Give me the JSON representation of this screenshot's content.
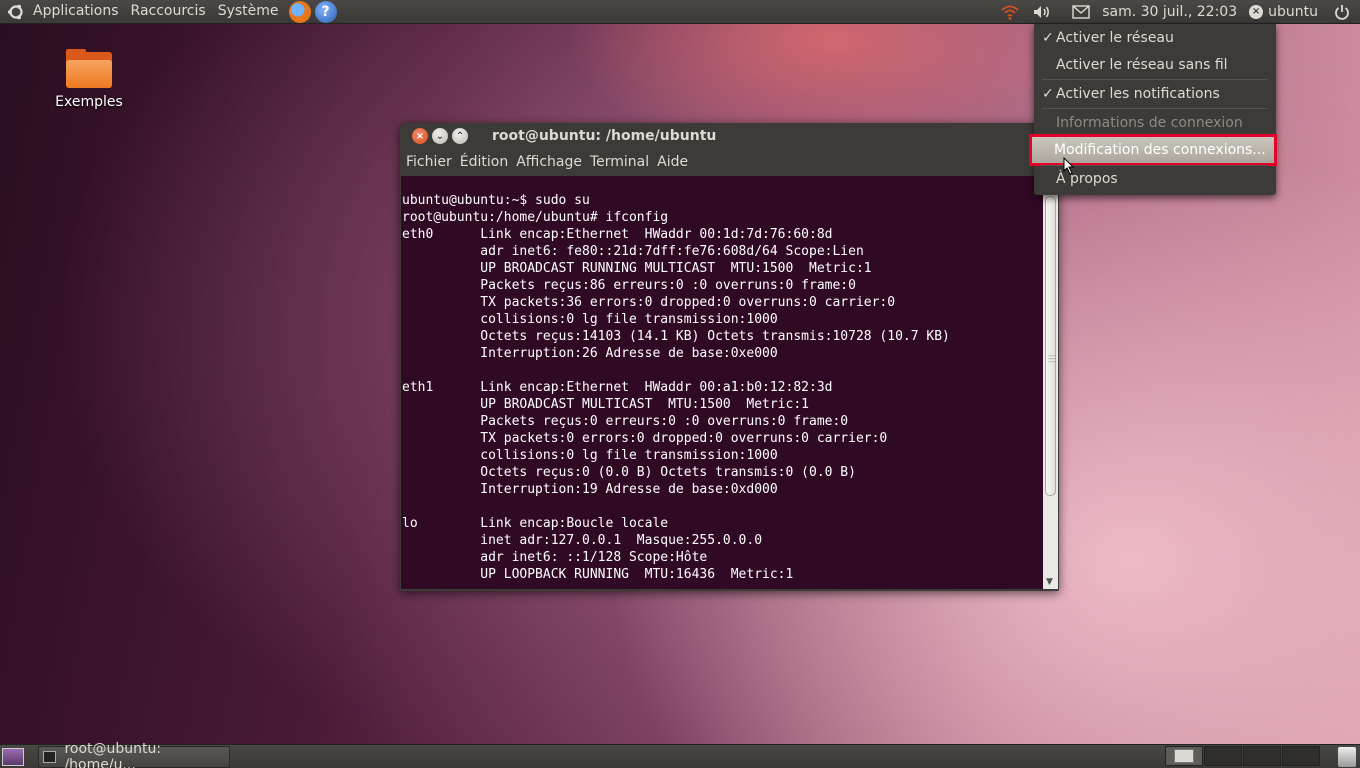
{
  "top_panel": {
    "menus": [
      "Applications",
      "Raccourcis",
      "Système"
    ],
    "help_glyph": "?",
    "clock": "sam. 30 juil., 22:03",
    "user": "ubuntu",
    "icons": [
      "ubuntu-logo-icon",
      "firefox-icon",
      "help-icon",
      "network-icon",
      "volume-icon",
      "mail-icon",
      "user-status-icon",
      "power-icon"
    ]
  },
  "desktop": {
    "icons": [
      {
        "label": "Exemples",
        "icon": "folder-icon"
      }
    ]
  },
  "terminal": {
    "title": "root@ubuntu: /home/ubuntu",
    "menu": [
      "Fichier",
      "Édition",
      "Affichage",
      "Terminal",
      "Aide"
    ],
    "lines": [
      "ubuntu@ubuntu:~$ sudo su",
      "root@ubuntu:/home/ubuntu# ifconfig",
      "eth0      Link encap:Ethernet  HWaddr 00:1d:7d:76:60:8d",
      "          adr inet6: fe80::21d:7dff:fe76:608d/64 Scope:Lien",
      "          UP BROADCAST RUNNING MULTICAST  MTU:1500  Metric:1",
      "          Packets reçus:86 erreurs:0 :0 overruns:0 frame:0",
      "          TX packets:36 errors:0 dropped:0 overruns:0 carrier:0",
      "          collisions:0 lg file transmission:1000",
      "          Octets reçus:14103 (14.1 KB) Octets transmis:10728 (10.7 KB)",
      "          Interruption:26 Adresse de base:0xe000",
      "",
      "eth1      Link encap:Ethernet  HWaddr 00:a1:b0:12:82:3d",
      "          UP BROADCAST MULTICAST  MTU:1500  Metric:1",
      "          Packets reçus:0 erreurs:0 :0 overruns:0 frame:0",
      "          TX packets:0 errors:0 dropped:0 overruns:0 carrier:0",
      "          collisions:0 lg file transmission:1000",
      "          Octets reçus:0 (0.0 B) Octets transmis:0 (0.0 B)",
      "          Interruption:19 Adresse de base:0xd000",
      "",
      "lo        Link encap:Boucle locale",
      "          inet adr:127.0.0.1  Masque:255.0.0.0",
      "          adr inet6: ::1/128 Scope:Hôte",
      "          UP LOOPBACK RUNNING  MTU:16436  Metric:1"
    ]
  },
  "network_menu": {
    "items": [
      {
        "label": "Activer le réseau",
        "checked": true,
        "state": "normal"
      },
      {
        "label": "Activer le réseau sans fil",
        "checked": false,
        "state": "normal"
      },
      {
        "label": "Activer les notifications",
        "checked": true,
        "state": "normal"
      },
      {
        "label": "Informations de connexion",
        "checked": false,
        "state": "disabled"
      },
      {
        "label": "Modification des connexions...",
        "checked": false,
        "state": "highlighted"
      },
      {
        "label": "À propos",
        "checked": false,
        "state": "normal"
      }
    ],
    "check_glyph": "✓",
    "highlight_color": "#e4002b"
  },
  "bottom_panel": {
    "task": "root@ubuntu: /home/u...",
    "workspace_count": 4,
    "active_workspace": 1
  }
}
